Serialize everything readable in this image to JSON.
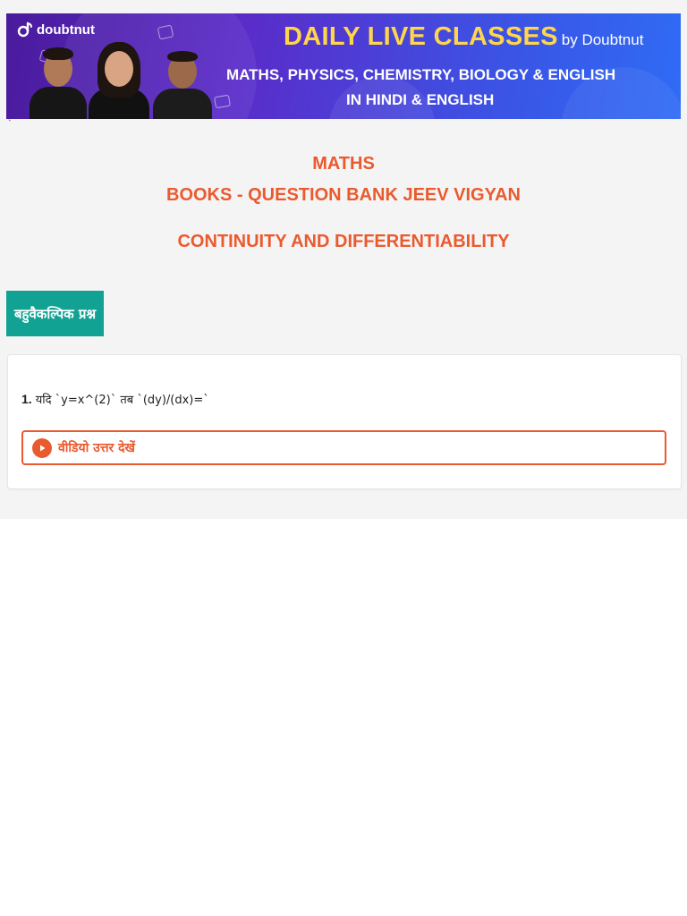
{
  "banner": {
    "brand": "doubtnut",
    "title": "DAILY LIVE CLASSES",
    "by": "by Doubtnut",
    "subjects": "MATHS, PHYSICS, CHEMISTRY, BIOLOGY & ENGLISH",
    "languages": "IN HINDI & ENGLISH",
    "colors": {
      "title": "#ffd54a",
      "gradient_start": "#4a1b9c",
      "gradient_end": "#2f6cf5"
    }
  },
  "stray_mark": "`",
  "header": {
    "subject": "MATHS",
    "book": "BOOKS - QUESTION BANK JEEV VIGYAN",
    "chapter": "CONTINUITY AND DIFFERENTIABILITY",
    "accent_color": "#ea5a2f"
  },
  "category": {
    "label": "बहुवैकल्पिक प्रश्न",
    "color": "#11a293"
  },
  "questions": [
    {
      "number": "1.",
      "text": "यदि `y=x^(2)` तब `(dy)/(dx)=`",
      "video_button_label": "वीडियो उत्तर देखें",
      "video_icon": "play-icon"
    }
  ]
}
